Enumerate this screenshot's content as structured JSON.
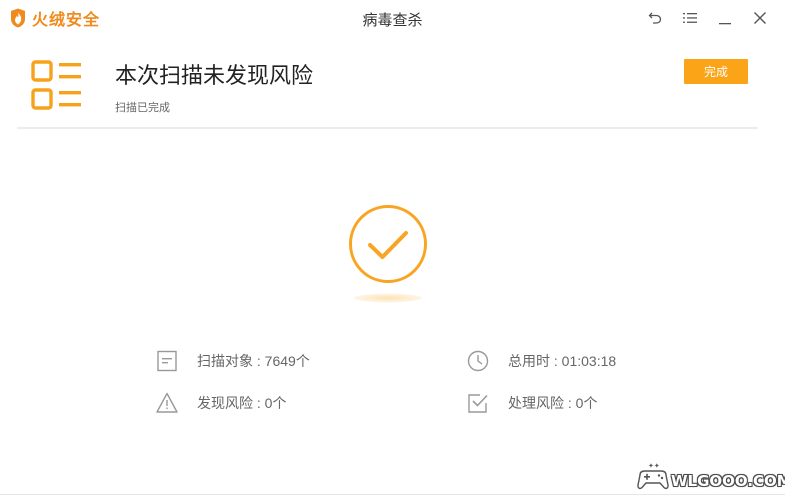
{
  "app": {
    "brand_name": "火绒安全",
    "window_title": "病毒查杀",
    "brand_color": "#f08a1c"
  },
  "window_controls": {
    "back_icon": "undo-arrow-icon",
    "menu_icon": "menu-lines-icon",
    "minimize_icon": "minimize-icon",
    "close_icon": "close-icon"
  },
  "result": {
    "headline": "本次扫描未发现风险",
    "subline": "扫描已完成",
    "done_button": "完成",
    "accent_color": "#fca418"
  },
  "stats": {
    "scanned_objects": "扫描对象 : 7649个",
    "total_time": "总用时 : 01:03:18",
    "found_risks": "发现风险 : 0个",
    "handled_risks": "处理风险 : 0个"
  },
  "watermark": {
    "text": "WLGOOO.COM"
  }
}
